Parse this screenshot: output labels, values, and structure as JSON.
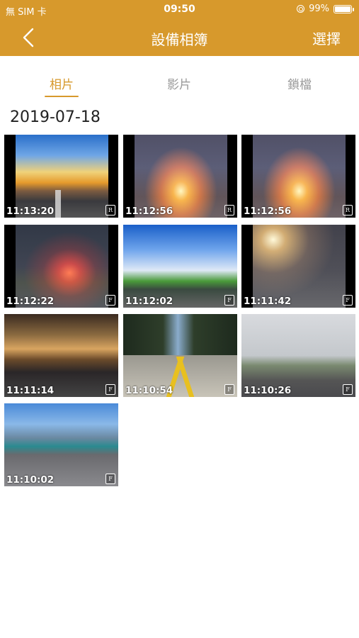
{
  "status_bar": {
    "carrier": "無 SIM 卡",
    "time": "09:50",
    "battery": "99%",
    "battery_level": 0.99
  },
  "nav": {
    "title": "設備相簿",
    "select_label": "選擇"
  },
  "tabs": [
    {
      "label": "相片",
      "active": true
    },
    {
      "label": "影片",
      "active": false
    },
    {
      "label": "鎖檔",
      "active": false
    }
  ],
  "date_header": "2019-07-18",
  "thumbnails": [
    {
      "time": "11:13:20",
      "badge": "R",
      "scene": "sunset-clouds-road"
    },
    {
      "time": "11:12:56",
      "badge": "R",
      "scene": "sunrise-road"
    },
    {
      "time": "11:12:56",
      "badge": "R",
      "scene": "sunrise-road"
    },
    {
      "time": "11:12:22",
      "badge": "F",
      "scene": "red-sunset-road"
    },
    {
      "time": "11:12:02",
      "badge": "F",
      "scene": "blue-sky-motion-road"
    },
    {
      "time": "11:11:42",
      "badge": "F",
      "scene": "stormy-sky-road"
    },
    {
      "time": "11:11:14",
      "badge": "F",
      "scene": "golden-desert-road"
    },
    {
      "time": "11:10:54",
      "badge": "F",
      "scene": "forest-yellow-line-road"
    },
    {
      "time": "11:10:26",
      "badge": "F",
      "scene": "foggy-tree-road"
    },
    {
      "time": "11:10:02",
      "badge": "F",
      "scene": "city-skyline-road"
    }
  ],
  "colors": {
    "accent": "#d7992c",
    "inactive_tab": "#9a9a9a"
  }
}
